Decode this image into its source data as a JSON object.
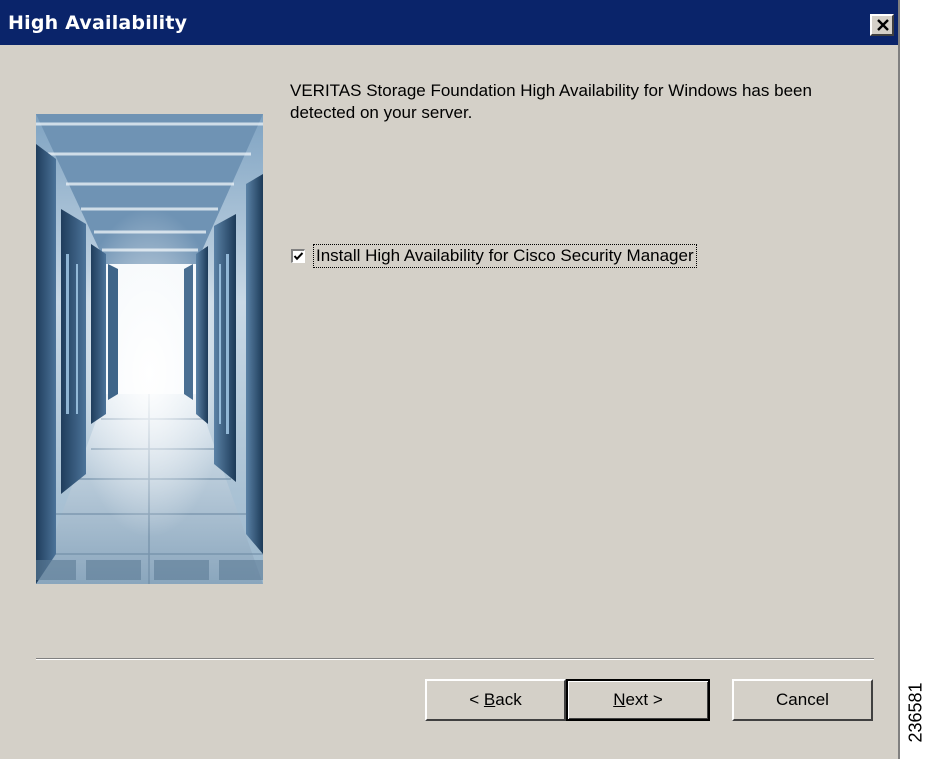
{
  "window": {
    "title": "High Availability",
    "close_icon": "close-icon"
  },
  "message": "VERITAS Storage Foundation High Availability for Windows has been detected on your server.",
  "option": {
    "label": "Install High Availability for Cisco Security Manager",
    "checked": true
  },
  "buttons": {
    "back_prefix": "< ",
    "back_mnemonic": "B",
    "back_rest": "ack",
    "next_mnemonic": "N",
    "next_rest": "ext >",
    "cancel": "Cancel"
  },
  "figure_id": "236581",
  "colors": {
    "titlebar": "#0a246a",
    "dialog_bg": "#d4d0c8"
  }
}
